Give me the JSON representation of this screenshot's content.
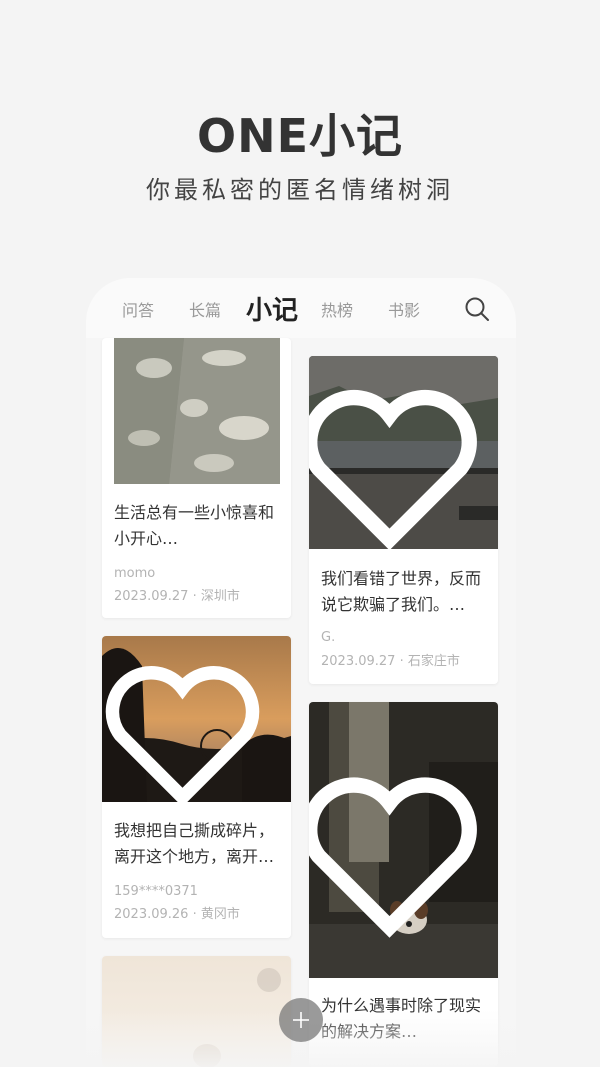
{
  "hero": {
    "title": "ONE小记",
    "subtitle": "你最私密的匿名情绪树洞"
  },
  "tabs": [
    {
      "label": "问答",
      "active": false
    },
    {
      "label": "长篇",
      "active": false
    },
    {
      "label": "小记",
      "active": true
    },
    {
      "label": "热榜",
      "active": false
    },
    {
      "label": "书影",
      "active": false
    }
  ],
  "icons": {
    "search": "search-icon",
    "heart": "heart-icon",
    "add": "plus-icon"
  },
  "cards": [
    {
      "text": "生活总有一些小惊喜和小开心…",
      "author": "momo",
      "date": "2023.09.27",
      "city": "深圳市"
    },
    {
      "text": "我们看错了世界，反而说它欺骗了我们。…",
      "author": "G.",
      "date": "2023.09.27",
      "city": "石家庄市"
    },
    {
      "text": "我想把自己撕成碎片，离开这个地方，离开…",
      "author": "159****0371",
      "date": "2023.09.26",
      "city": "黄冈市"
    },
    {
      "text": "为什么遇事时除了现实的解决方案…",
      "author": "",
      "date": "",
      "city": ""
    }
  ],
  "meta_separator": "·",
  "colors": {
    "background": "#f4f4f4",
    "card": "#ffffff",
    "text_primary": "#333333",
    "text_secondary": "#b3b3b3"
  }
}
